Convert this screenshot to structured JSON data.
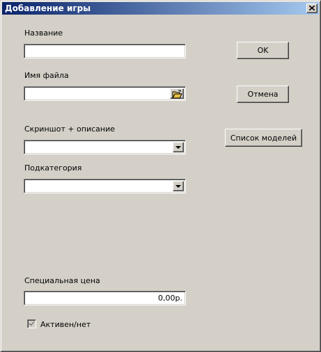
{
  "window": {
    "title": "Добавление игры",
    "close_glyph": "×"
  },
  "form": {
    "name_label": "Название",
    "name_value": "",
    "filename_label": "Имя файла",
    "filename_value": "",
    "screenshot_label": "Скриншот + описание",
    "screenshot_value": "",
    "subcategory_label": "Подкатегория",
    "subcategory_value": "",
    "price_label": "Специальная цена",
    "price_value": "0,00р.",
    "active_label": "Активен/нет",
    "active_checked": true
  },
  "buttons": {
    "ok_label": "OK",
    "cancel_label": "Отмена",
    "models_label": "Список моделей"
  },
  "icons": {
    "close": "close-icon",
    "browse": "folder-open-icon",
    "dropdown": "chevron-down-icon",
    "check": "check-icon"
  }
}
